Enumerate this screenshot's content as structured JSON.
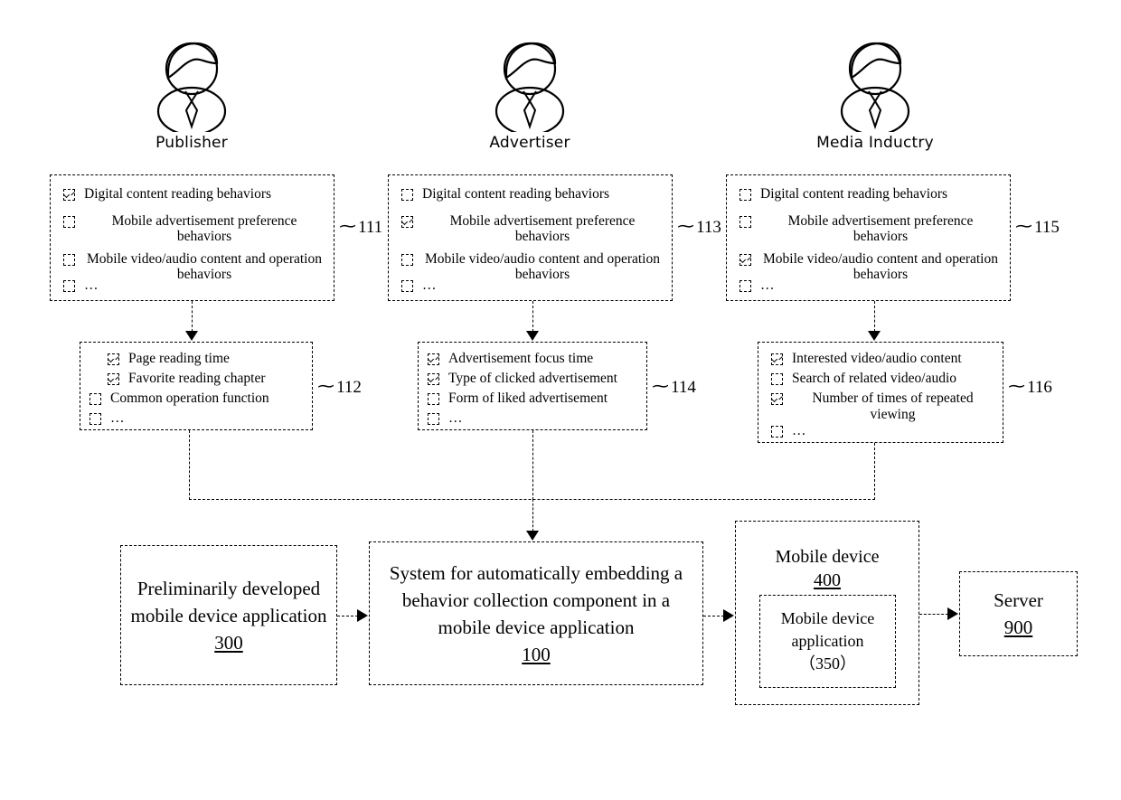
{
  "figure": {
    "title": "System for automatically embedding a behavior collection component in a mobile device application"
  },
  "actors": [
    {
      "label": "Publisher",
      "icon": "user-avatar-icon"
    },
    {
      "label": "Advertiser",
      "icon": "user-avatar-icon"
    },
    {
      "label": "Media Inductry",
      "icon": "user-avatar-icon"
    }
  ],
  "category_boxes": [
    {
      "ref": "111",
      "items": [
        {
          "label": "Digital content reading behaviors",
          "checked": true
        },
        {
          "label": "Mobile advertisement preference behaviors",
          "checked": false
        },
        {
          "label": "Mobile video/audio content and operation behaviors",
          "checked": false
        },
        {
          "label": "…",
          "checked": false
        }
      ]
    },
    {
      "ref": "113",
      "items": [
        {
          "label": "Digital content reading behaviors",
          "checked": false
        },
        {
          "label": "Mobile advertisement preference behaviors",
          "checked": true
        },
        {
          "label": "Mobile video/audio content and operation behaviors",
          "checked": false
        },
        {
          "label": "…",
          "checked": false
        }
      ]
    },
    {
      "ref": "115",
      "items": [
        {
          "label": "Digital content reading behaviors",
          "checked": false
        },
        {
          "label": "Mobile advertisement preference behaviors",
          "checked": false
        },
        {
          "label": "Mobile video/audio content and operation behaviors",
          "checked": true
        },
        {
          "label": "…",
          "checked": false
        }
      ]
    }
  ],
  "detail_boxes": [
    {
      "ref": "112",
      "items": [
        {
          "label": "Page reading time",
          "checked": true
        },
        {
          "label": "Favorite reading chapter",
          "checked": true
        },
        {
          "label": "Common operation function",
          "checked": false
        },
        {
          "label": "…",
          "checked": false
        }
      ]
    },
    {
      "ref": "114",
      "items": [
        {
          "label": "Advertisement focus time",
          "checked": true
        },
        {
          "label": "Type of clicked advertisement",
          "checked": true
        },
        {
          "label": "Form of liked advertisement",
          "checked": false
        },
        {
          "label": "…",
          "checked": false
        }
      ]
    },
    {
      "ref": "116",
      "items": [
        {
          "label": "Interested video/audio content",
          "checked": true
        },
        {
          "label": "Search of related video/audio",
          "checked": false
        },
        {
          "label": "Number of times of repeated viewing",
          "checked": true
        },
        {
          "label": "…",
          "checked": false
        }
      ]
    }
  ],
  "blocks": {
    "preliminary_app": {
      "text": "Preliminarily developed mobile device application",
      "number": "300"
    },
    "system": {
      "text": "System for automatically embedding a behavior collection component in a mobile device application",
      "number": "100"
    },
    "mobile_device": {
      "text": "Mobile device",
      "number": "400"
    },
    "mobile_app": {
      "text": "Mobile device application",
      "number": "（350）"
    },
    "server": {
      "text": "Server",
      "number": "900"
    }
  },
  "colors": {
    "line": "#000000",
    "background": "#ffffff"
  }
}
